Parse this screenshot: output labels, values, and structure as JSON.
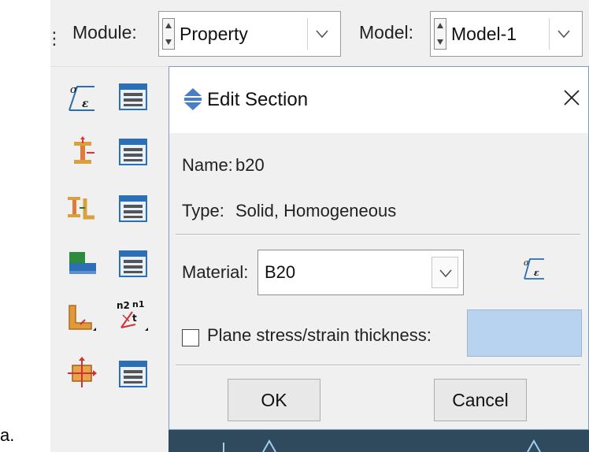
{
  "figure_label": "a.",
  "toolbar": {
    "module_label": "Module:",
    "module_value": "Property",
    "model_label": "Model:",
    "model_value": "Model-1"
  },
  "toolbox": {
    "icons": [
      "material-icon",
      "material-manager-icon",
      "section-icon",
      "section-manager-icon",
      "profile-icon",
      "profile-manager-icon",
      "assign-section-icon",
      "section-assignment-manager-icon",
      "assign-beam-orientation-icon",
      "assign-normal-tangent-icon",
      "skin-icon",
      "skin-manager-icon"
    ]
  },
  "dialog": {
    "title": "Edit Section",
    "name_label": "Name:",
    "name_value": "b20",
    "type_label": "Type:",
    "type_value": "Solid, Homogeneous",
    "material_label": "Material:",
    "material_value": "B20",
    "plane_stress_label": "Plane stress/strain thickness:",
    "plane_stress_checked": false,
    "thickness_value": "",
    "ok_label": "OK",
    "cancel_label": "Cancel"
  },
  "colors": {
    "window_bg": "#f0f0f0",
    "thickness_field": "#b8d3ef",
    "dialog_border": "#7a9cc6",
    "status_bar": "#2f4a5c"
  }
}
